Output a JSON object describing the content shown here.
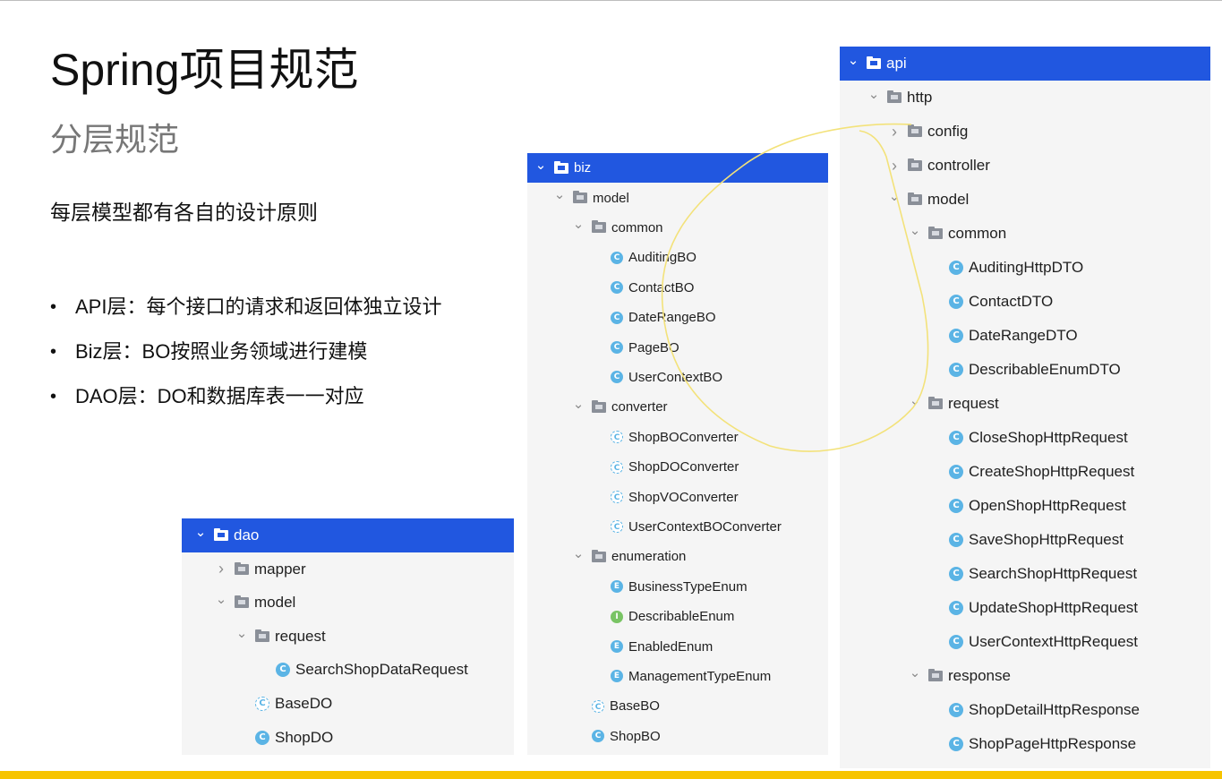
{
  "slide": {
    "title": "Spring项目规范",
    "subtitle": "分层规范",
    "intro": "每层模型都有各自的设计原则",
    "bullets": [
      "API层：每个接口的请求和返回体独立设计",
      "Biz层：BO按照业务领域进行建模",
      "DAO层：DO和数据库表一一对应"
    ],
    "bullet_glyph": "•"
  },
  "colors": {
    "selection": "#2157e0",
    "accent_bar": "#f7c400",
    "class_icon": "#5bb4e5",
    "interface_icon": "#79c464",
    "annotation": "#f3e27a"
  },
  "icon_letters": {
    "class": "C",
    "enum": "E",
    "interface": "I"
  },
  "dao_tree": [
    {
      "label": "dao",
      "kind": "folder",
      "depth": 0,
      "arrow": "expanded",
      "selected": true
    },
    {
      "label": "mapper",
      "kind": "folder",
      "depth": 1,
      "arrow": "collapsed"
    },
    {
      "label": "model",
      "kind": "folder",
      "depth": 1,
      "arrow": "expanded"
    },
    {
      "label": "request",
      "kind": "folder",
      "depth": 2,
      "arrow": "expanded"
    },
    {
      "label": "SearchShopDataRequest",
      "kind": "class",
      "depth": 3
    },
    {
      "label": "BaseDO",
      "kind": "abstract",
      "depth": 2
    },
    {
      "label": "ShopDO",
      "kind": "class",
      "depth": 2
    }
  ],
  "biz_tree": [
    {
      "label": "biz",
      "kind": "folder",
      "depth": 0,
      "arrow": "expanded",
      "selected": true
    },
    {
      "label": "model",
      "kind": "folder",
      "depth": 1,
      "arrow": "expanded"
    },
    {
      "label": "common",
      "kind": "folder",
      "depth": 2,
      "arrow": "expanded"
    },
    {
      "label": "AuditingBO",
      "kind": "class",
      "depth": 3
    },
    {
      "label": "ContactBO",
      "kind": "class",
      "depth": 3
    },
    {
      "label": "DateRangeBO",
      "kind": "class",
      "depth": 3
    },
    {
      "label": "PageBO",
      "kind": "class",
      "depth": 3
    },
    {
      "label": "UserContextBO",
      "kind": "class",
      "depth": 3
    },
    {
      "label": "converter",
      "kind": "folder",
      "depth": 2,
      "arrow": "expanded"
    },
    {
      "label": "ShopBOConverter",
      "kind": "abstract",
      "depth": 3
    },
    {
      "label": "ShopDOConverter",
      "kind": "abstract",
      "depth": 3
    },
    {
      "label": "ShopVOConverter",
      "kind": "abstract",
      "depth": 3
    },
    {
      "label": "UserContextBOConverter",
      "kind": "abstract",
      "depth": 3
    },
    {
      "label": "enumeration",
      "kind": "folder",
      "depth": 2,
      "arrow": "expanded"
    },
    {
      "label": "BusinessTypeEnum",
      "kind": "enum",
      "depth": 3
    },
    {
      "label": "DescribableEnum",
      "kind": "interface",
      "depth": 3
    },
    {
      "label": "EnabledEnum",
      "kind": "enum",
      "depth": 3
    },
    {
      "label": "ManagementTypeEnum",
      "kind": "enum",
      "depth": 3
    },
    {
      "label": "BaseBO",
      "kind": "abstract",
      "depth": 2
    },
    {
      "label": "ShopBO",
      "kind": "class",
      "depth": 2
    }
  ],
  "api_tree": [
    {
      "label": "api",
      "kind": "folder",
      "depth": 0,
      "arrow": "expanded",
      "selected": true
    },
    {
      "label": "http",
      "kind": "folder",
      "depth": 1,
      "arrow": "expanded"
    },
    {
      "label": "config",
      "kind": "folder",
      "depth": 2,
      "arrow": "collapsed"
    },
    {
      "label": "controller",
      "kind": "folder",
      "depth": 2,
      "arrow": "collapsed"
    },
    {
      "label": "model",
      "kind": "folder",
      "depth": 2,
      "arrow": "expanded"
    },
    {
      "label": "common",
      "kind": "folder",
      "depth": 3,
      "arrow": "expanded"
    },
    {
      "label": "AuditingHttpDTO",
      "kind": "class",
      "depth": 4
    },
    {
      "label": "ContactDTO",
      "kind": "class",
      "depth": 4
    },
    {
      "label": "DateRangeDTO",
      "kind": "class",
      "depth": 4
    },
    {
      "label": "DescribableEnumDTO",
      "kind": "class",
      "depth": 4
    },
    {
      "label": "request",
      "kind": "folder",
      "depth": 3,
      "arrow": "expanded"
    },
    {
      "label": "CloseShopHttpRequest",
      "kind": "class",
      "depth": 4
    },
    {
      "label": "CreateShopHttpRequest",
      "kind": "class",
      "depth": 4
    },
    {
      "label": "OpenShopHttpRequest",
      "kind": "class",
      "depth": 4
    },
    {
      "label": "SaveShopHttpRequest",
      "kind": "class",
      "depth": 4
    },
    {
      "label": "SearchShopHttpRequest",
      "kind": "class",
      "depth": 4
    },
    {
      "label": "UpdateShopHttpRequest",
      "kind": "class",
      "depth": 4
    },
    {
      "label": "UserContextHttpRequest",
      "kind": "class",
      "depth": 4
    },
    {
      "label": "response",
      "kind": "folder",
      "depth": 3,
      "arrow": "expanded"
    },
    {
      "label": "ShopDetailHttpResponse",
      "kind": "class",
      "depth": 4
    },
    {
      "label": "ShopPageHttpResponse",
      "kind": "class",
      "depth": 4
    }
  ]
}
